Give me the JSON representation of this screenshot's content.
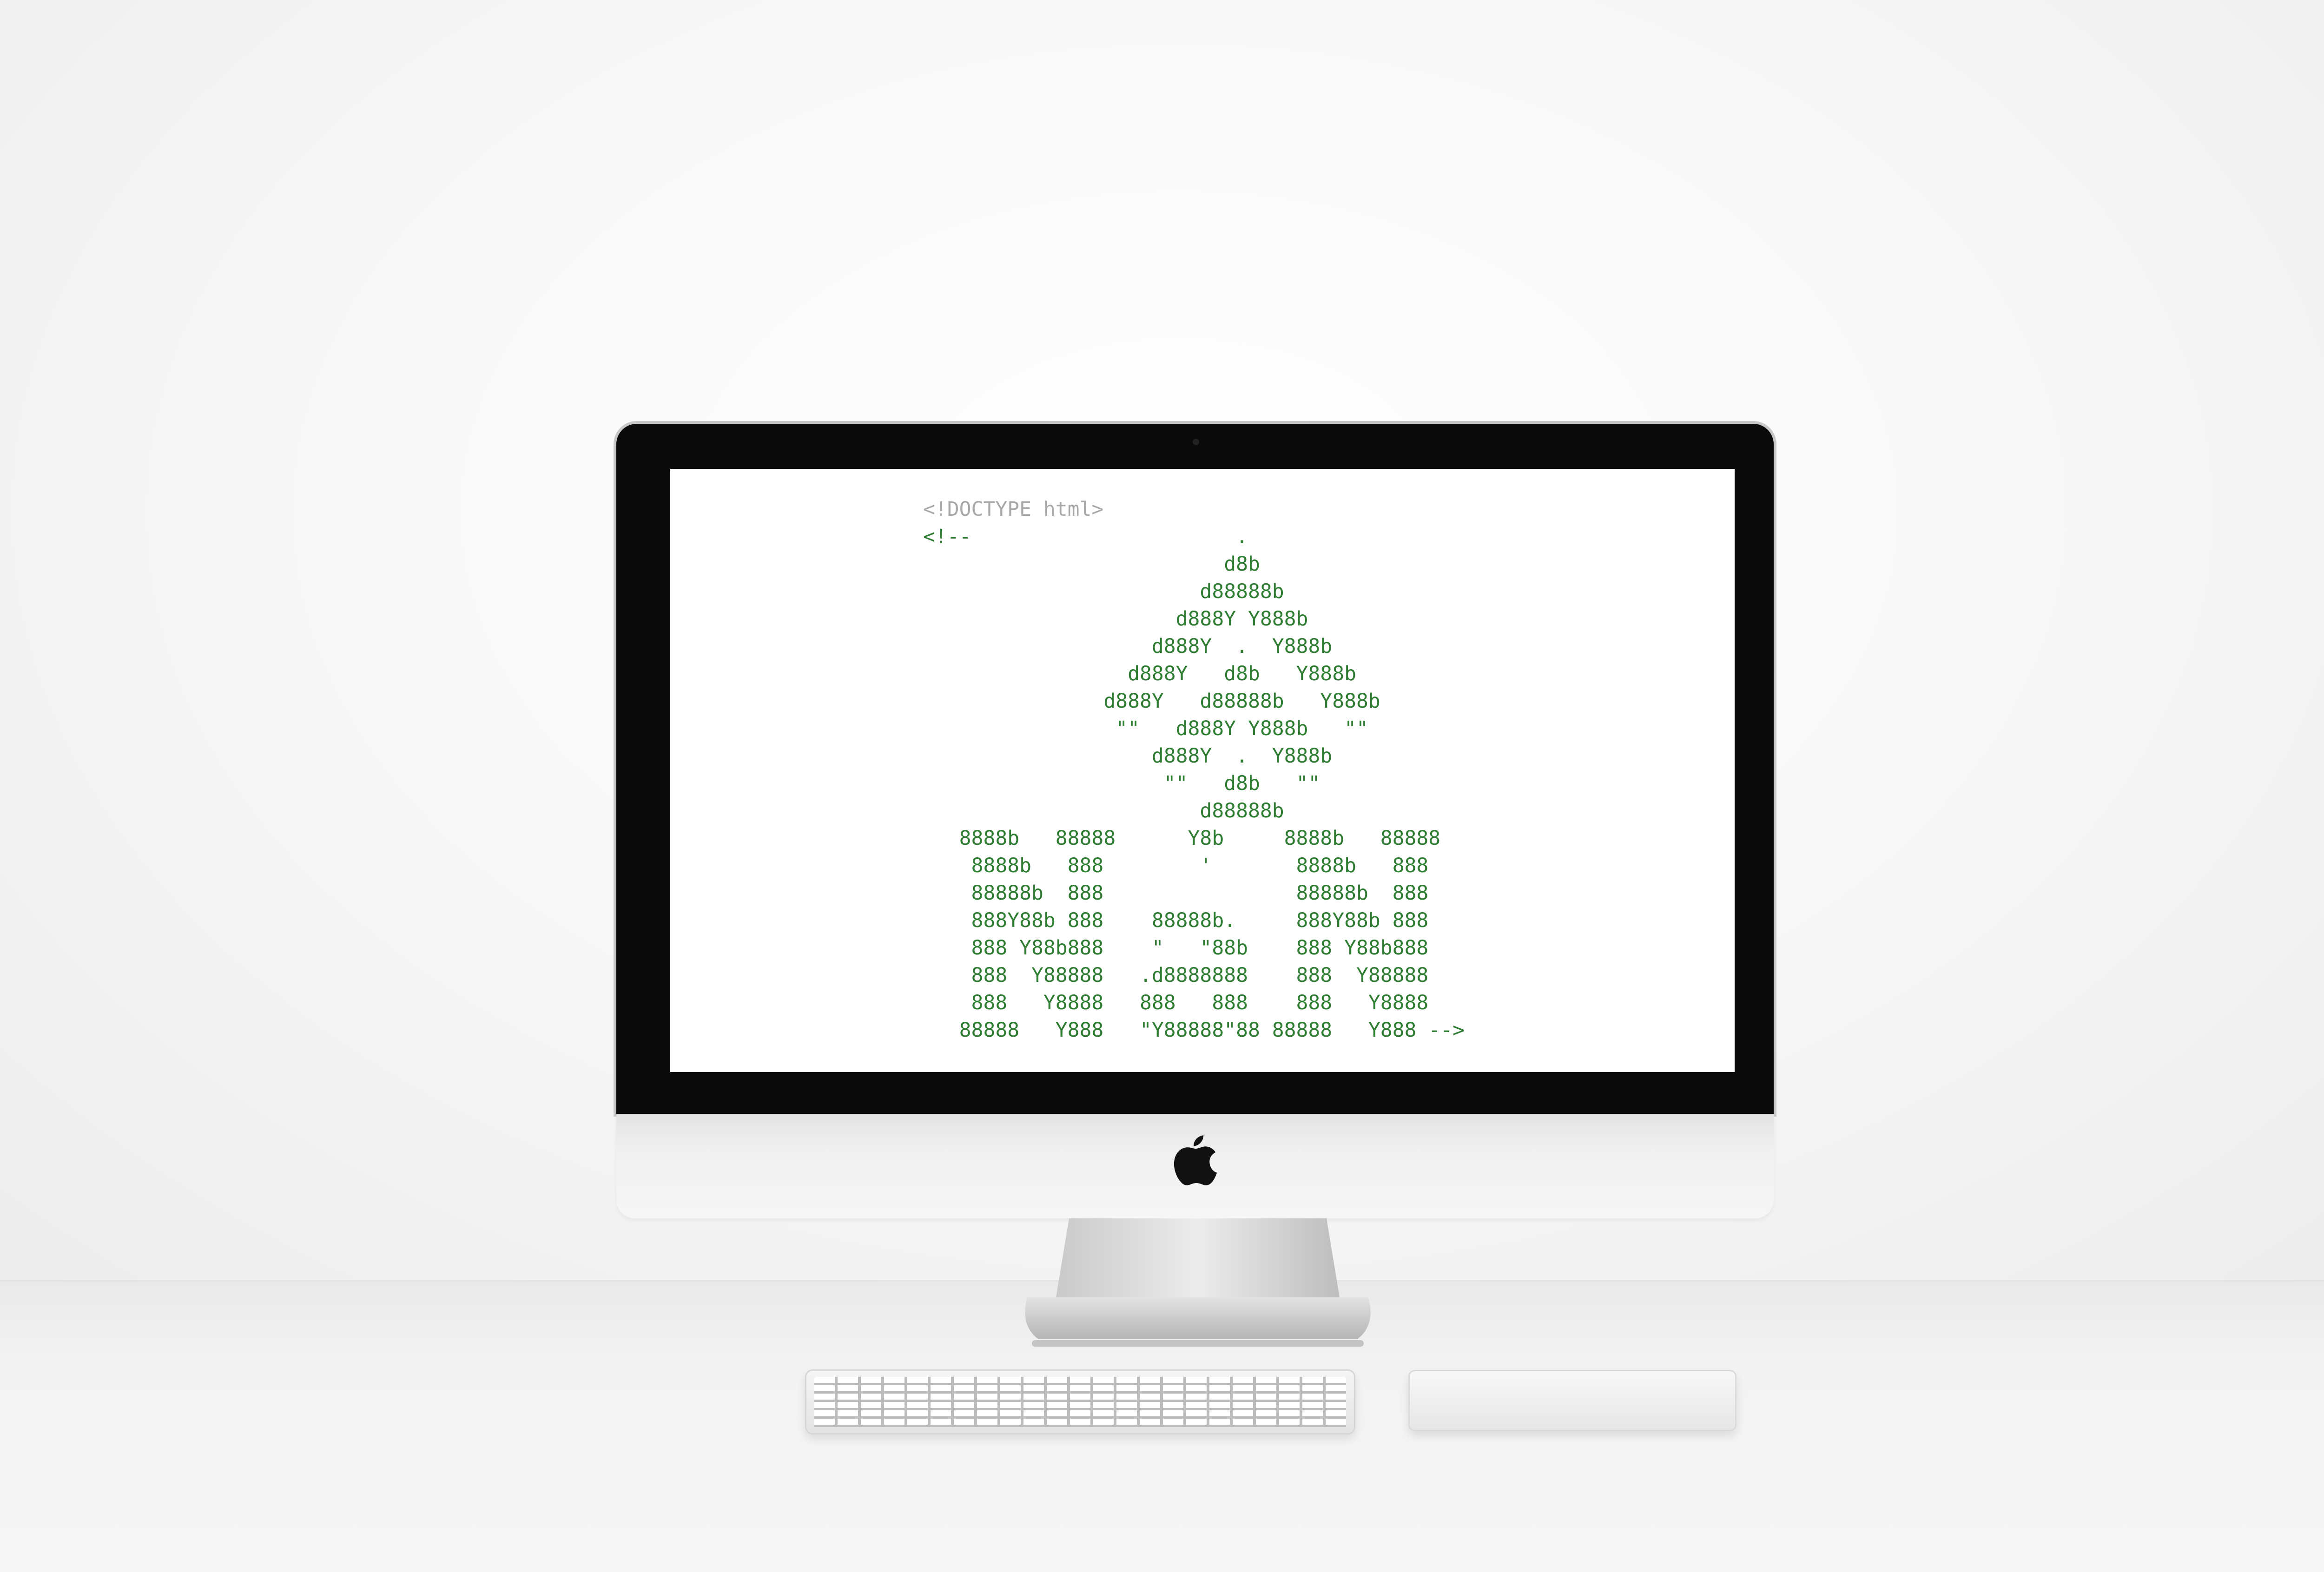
{
  "scene": {
    "device": "iMac",
    "accessories": [
      "keyboard",
      "trackpad"
    ]
  },
  "screen": {
    "doctype_line": "<!DOCTYPE html>",
    "ascii_art": "<!--                      .\n                         d8b\n                       d88888b\n                     d888Y Y888b\n                   d888Y  .  Y888b\n                 d888Y   d8b   Y888b\n               d888Y   d88888b   Y888b\n                \"\"   d888Y Y888b   \"\"\n                   d888Y  .  Y888b\n                    \"\"   d8b   \"\"\n                       d88888b\n   8888b   88888      Y8b     8888b   88888\n    8888b   888        '       8888b   888\n    88888b  888                88888b  888\n    888Y88b 888    88888b.     888Y88b 888\n    888 Y88b888    \"   \"88b    888 Y88b888\n    888  Y88888   .d8888888    888  Y88888\n    888   Y8888   888   888    888   Y8888\n   88888   Y888   \"Y88888\"88 88888   Y888 -->",
    "text_color": "#2e7d32",
    "doctype_color": "#a8a8a8"
  },
  "icons": {
    "logo": "apple-logo-icon"
  }
}
